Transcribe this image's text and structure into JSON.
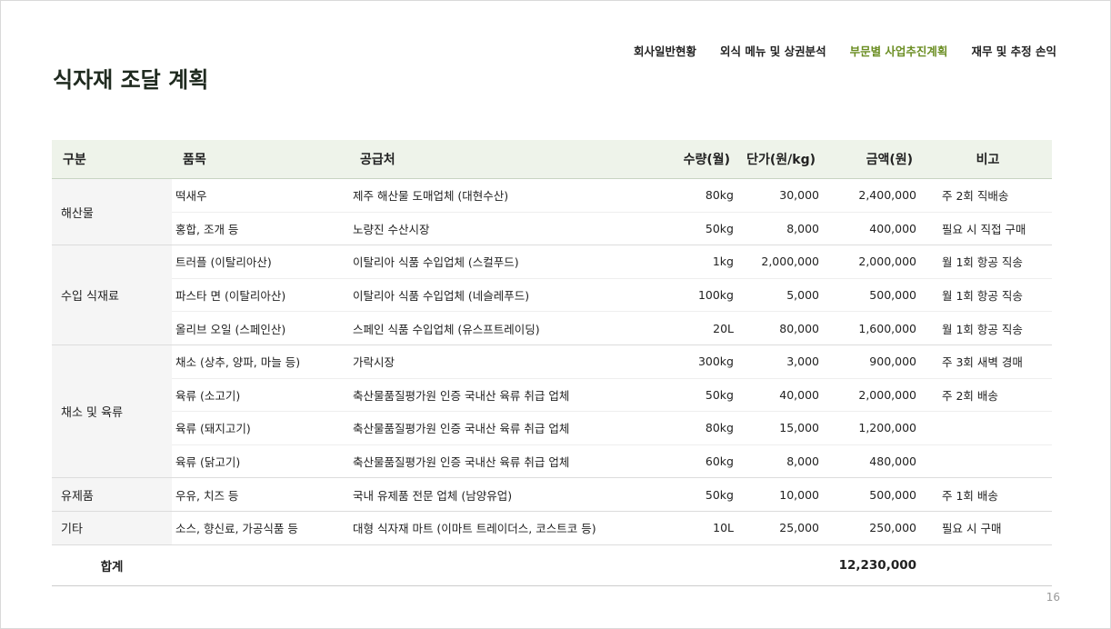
{
  "nav": {
    "items": [
      {
        "label": "회사일반현황",
        "active": false
      },
      {
        "label": "외식 메뉴 및 상권분석",
        "active": false
      },
      {
        "label": "부문별 사업추진계획",
        "active": true
      },
      {
        "label": "재무 및 추정 손익",
        "active": false
      }
    ],
    "active_color": "#6b8e23"
  },
  "title": "식자재 조달 계획",
  "table": {
    "headers": [
      "구분",
      "품목",
      "공급처",
      "수량(월)",
      "단가(원/kg)",
      "금액(원)",
      "비고"
    ],
    "groups": [
      {
        "category": "해산물",
        "rows": [
          {
            "item": "떡새우",
            "supplier": "제주 해산물 도매업체 (대현수산)",
            "qty": "80kg",
            "price": "30,000",
            "amount": "2,400,000",
            "note": "주 2회 직배송"
          },
          {
            "item": "홍합, 조개 등",
            "supplier": "노량진 수산시장",
            "qty": "50kg",
            "price": "8,000",
            "amount": "400,000",
            "note": "필요 시 직접 구매"
          }
        ]
      },
      {
        "category": "수입 식재료",
        "rows": [
          {
            "item": "트러플 (이탈리아산)",
            "supplier": "이탈리아 식품 수입업체 (스컬푸드)",
            "qty": "1kg",
            "price": "2,000,000",
            "amount": "2,000,000",
            "note": "월 1회 항공 직송"
          },
          {
            "item": "파스타 면 (이탈리아산)",
            "supplier": "이탈리아 식품 수입업체 (네슬레푸드)",
            "qty": "100kg",
            "price": "5,000",
            "amount": "500,000",
            "note": "월 1회 항공 직송"
          },
          {
            "item": "올리브 오일 (스페인산)",
            "supplier": "스페인 식품 수입업체 (유스프트레이딩)",
            "qty": "20L",
            "price": "80,000",
            "amount": "1,600,000",
            "note": "월 1회 항공 직송"
          }
        ]
      },
      {
        "category": "채소 및 육류",
        "rows": [
          {
            "item": "채소 (상추, 양파, 마늘 등)",
            "supplier": "가락시장",
            "qty": "300kg",
            "price": "3,000",
            "amount": "900,000",
            "note": "주 3회 새벽 경매"
          },
          {
            "item": "육류 (소고기)",
            "supplier": "축산물품질평가원 인증 국내산 육류 취급 업체",
            "qty": "50kg",
            "price": "40,000",
            "amount": "2,000,000",
            "note": "주 2회 배송"
          },
          {
            "item": "육류 (돼지고기)",
            "supplier": "축산물품질평가원 인증 국내산 육류 취급 업체",
            "qty": "80kg",
            "price": "15,000",
            "amount": "1,200,000",
            "note": ""
          },
          {
            "item": "육류 (닭고기)",
            "supplier": "축산물품질평가원 인증 국내산 육류 취급 업체",
            "qty": "60kg",
            "price": "8,000",
            "amount": "480,000",
            "note": ""
          }
        ]
      },
      {
        "category": "유제품",
        "rows": [
          {
            "item": "우유, 치즈 등",
            "supplier": "국내 유제품 전문 업체 (남양유업)",
            "qty": "50kg",
            "price": "10,000",
            "amount": "500,000",
            "note": "주 1회 배송"
          }
        ]
      },
      {
        "category": "기타",
        "rows": [
          {
            "item": "소스, 향신료, 가공식품 등",
            "supplier": "대형 식자재 마트 (이마트 트레이더스, 코스트코 등)",
            "qty": "10L",
            "price": "25,000",
            "amount": "250,000",
            "note": "필요 시 구매"
          }
        ]
      }
    ],
    "total_label": "합계",
    "total_amount": "12,230,000"
  },
  "page_number": "16"
}
